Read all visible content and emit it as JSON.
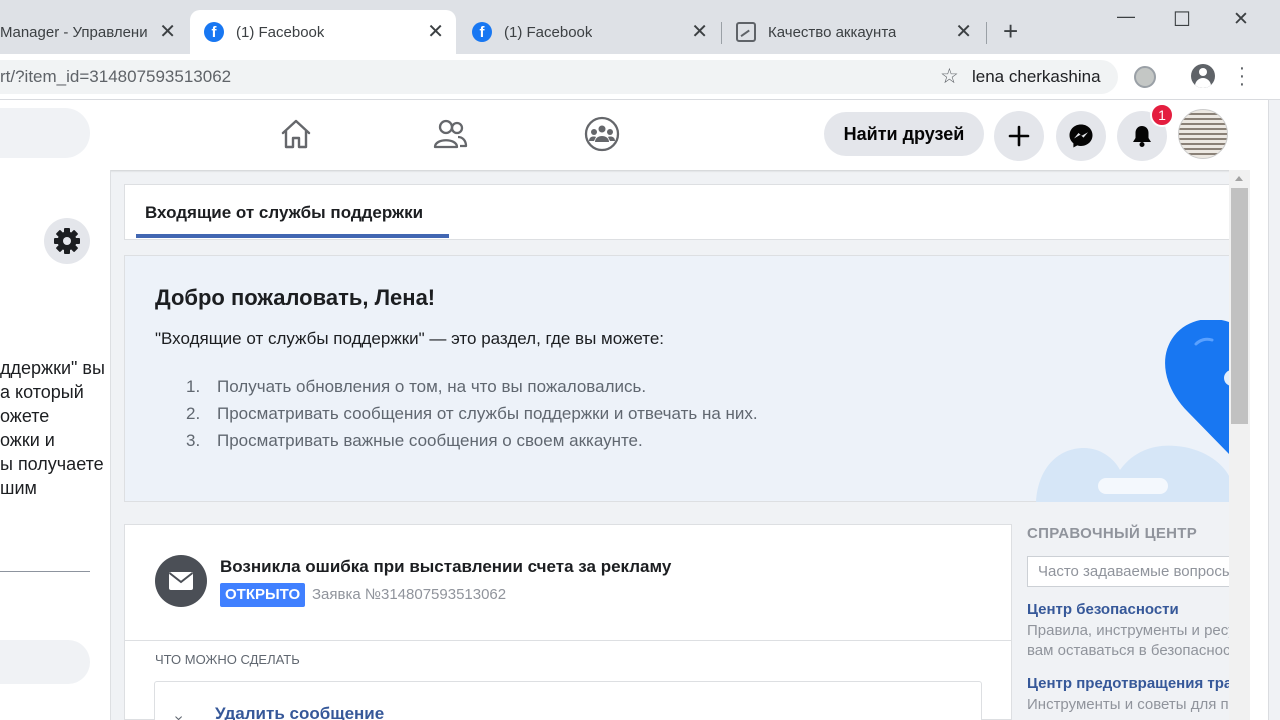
{
  "browser": {
    "tabs": [
      {
        "title": "Manager - Управлени",
        "favicon": "document-icon",
        "active": false
      },
      {
        "title": "(1) Facebook",
        "favicon": "facebook-icon",
        "active": true
      },
      {
        "title": "(1) Facebook",
        "favicon": "facebook-icon",
        "active": false
      },
      {
        "title": "Качество аккаунта",
        "favicon": "account-quality-icon",
        "active": false
      }
    ],
    "close_glyph": "✕",
    "new_tab_glyph": "+",
    "window_controls": {
      "minimize": "—",
      "maximize": "☐",
      "close": "✕"
    },
    "url": "rt/?item_id=314807593513062",
    "profile_name": "lena cherkashina"
  },
  "fb_nav": {
    "find_friends_label": "Найти друзей",
    "notification_count": "1",
    "colors": {
      "brand": "#1877f2",
      "badge": "#e41e3f"
    }
  },
  "left_panel": {
    "description_lines": [
      "ддержки\" вы",
      "а который",
      "ожете",
      "ожки и",
      "ы получаете",
      "шим"
    ]
  },
  "main": {
    "tab_label": "Входящие от службы поддержки",
    "welcome": {
      "title": "Добро пожаловать, Лена!",
      "intro": "\"Входящие от службы поддержки\" — это раздел, где вы можете:",
      "items": [
        {
          "num": "1.",
          "text": "Получать обновления о том, на что вы пожаловались."
        },
        {
          "num": "2.",
          "text": "Просматривать сообщения от службы поддержки и отвечать на них."
        },
        {
          "num": "3.",
          "text": "Просматривать важные сообщения о своем аккаунте."
        }
      ]
    },
    "message": {
      "title": "Возникла ошибка при выставлении счета за рекламу",
      "status": "ОТКРЫТО",
      "ticket": "Заявка №314807593513062",
      "actions_heading": "ЧТО МОЖНО СДЕЛАТЬ",
      "action_label": "Удалить сообщение"
    }
  },
  "help_center": {
    "heading": "СПРАВОЧНЫЙ ЦЕНТР",
    "search_placeholder": "Часто задаваемые вопросы",
    "links": [
      {
        "title": "Центр безопасности",
        "desc": [
          "Правила, инструменты и ресурсы",
          "вам оставаться в безопасности"
        ]
      },
      {
        "title": "Центр предотвращения травли",
        "desc": [
          "Инструменты и советы для п"
        ]
      }
    ]
  }
}
